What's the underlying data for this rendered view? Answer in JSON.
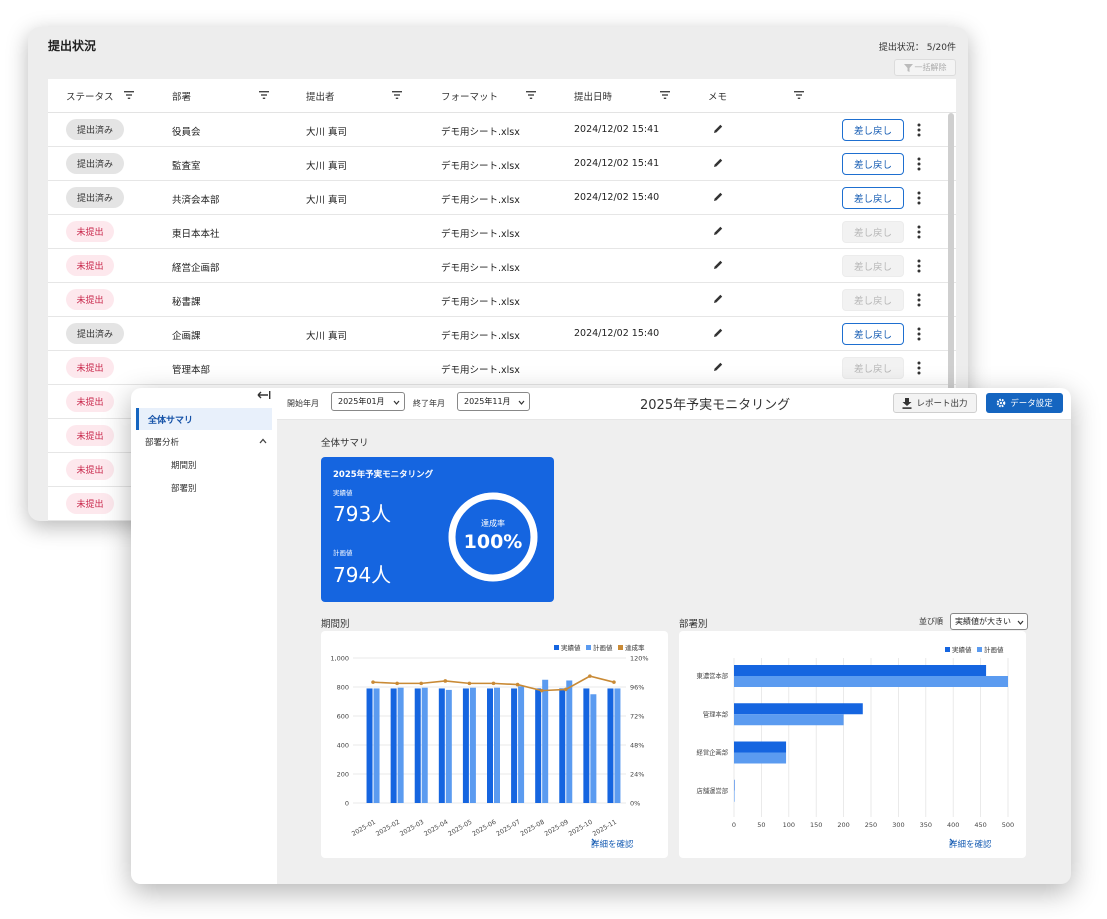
{
  "status_window": {
    "title": "提出状況",
    "count_text": "提出状況： 5/20件",
    "clear_button": "一括解除",
    "columns": [
      "ステータス",
      "部署",
      "提出者",
      "フォーマット",
      "提出日時",
      "メモ"
    ],
    "return_label": "差し戻し",
    "rows": [
      {
        "status": "提出済み",
        "dept": "役員会",
        "submitter": "大川 真司",
        "format": "デモ用シート.xlsx",
        "date": "2024/12/02 15:41"
      },
      {
        "status": "提出済み",
        "dept": "監査室",
        "submitter": "大川 真司",
        "format": "デモ用シート.xlsx",
        "date": "2024/12/02 15:41"
      },
      {
        "status": "提出済み",
        "dept": "共済会本部",
        "submitter": "大川 真司",
        "format": "デモ用シート.xlsx",
        "date": "2024/12/02 15:40"
      },
      {
        "status": "未提出",
        "dept": "東日本本社",
        "submitter": "",
        "format": "デモ用シート.xlsx",
        "date": ""
      },
      {
        "status": "未提出",
        "dept": "経営企画部",
        "submitter": "",
        "format": "デモ用シート.xlsx",
        "date": ""
      },
      {
        "status": "未提出",
        "dept": "秘書課",
        "submitter": "",
        "format": "デモ用シート.xlsx",
        "date": ""
      },
      {
        "status": "提出済み",
        "dept": "企画課",
        "submitter": "大川 真司",
        "format": "デモ用シート.xlsx",
        "date": "2024/12/02 15:40"
      },
      {
        "status": "未提出",
        "dept": "管理本部",
        "submitter": "",
        "format": "デモ用シート.xlsx",
        "date": ""
      },
      {
        "status": "未提出",
        "dept": "",
        "submitter": "",
        "format": "",
        "date": ""
      },
      {
        "status": "未提出",
        "dept": "",
        "submitter": "",
        "format": "",
        "date": ""
      },
      {
        "status": "未提出",
        "dept": "",
        "submitter": "",
        "format": "",
        "date": ""
      },
      {
        "status": "未提出",
        "dept": "",
        "submitter": "",
        "format": "",
        "date": ""
      }
    ]
  },
  "dashboard": {
    "sidebar": {
      "items": [
        {
          "label": "全体サマリ"
        },
        {
          "label": "部署分析"
        },
        {
          "label": "期間別"
        },
        {
          "label": "部署別"
        }
      ]
    },
    "topbar": {
      "start_label": "開始年月",
      "start_value": "2025年01月",
      "end_label": "終了年月",
      "end_value": "2025年11月",
      "title": "2025年予実モニタリング",
      "report_button": "レポート出力",
      "data_button": "データ設定"
    },
    "summary": {
      "section_label": "全体サマリ",
      "card_title": "2025年予実モニタリング",
      "actual_label": "実績値",
      "actual_value": "793人",
      "plan_label": "計画値",
      "plan_value": "794人",
      "rate_label": "達成率",
      "rate_value": "100%",
      "rate_fraction": 1.0
    },
    "period_section_label": "期間別",
    "dept_section_label": "部署別",
    "sort_label": "並び順",
    "sort_value": "実績値が大きい",
    "detail_link": "詳細を確認",
    "colors": {
      "actual": "#1565e0",
      "plan": "#5b9bf0",
      "rate": "#c98a35",
      "card_blue": "#1565e0"
    }
  },
  "chart_data": [
    {
      "type": "bar",
      "categories": [
        "2025-01",
        "2025-02",
        "2025-03",
        "2025-04",
        "2025-05",
        "2025-06",
        "2025-07",
        "2025-08",
        "2025-09",
        "2025-10",
        "2025-11"
      ],
      "series": [
        {
          "name": "実績値",
          "values": [
            790,
            790,
            790,
            790,
            790,
            790,
            790,
            790,
            790,
            790,
            790
          ],
          "axis": "left"
        },
        {
          "name": "計画値",
          "values": [
            790,
            795,
            795,
            780,
            795,
            795,
            805,
            850,
            845,
            750,
            790
          ],
          "axis": "left"
        },
        {
          "name": "達成率",
          "type": "line",
          "values": [
            100,
            99,
            99,
            101,
            99,
            99,
            98,
            93,
            94,
            105,
            100
          ],
          "axis": "right"
        }
      ],
      "y_left_ticks": [
        "0",
        "200",
        "400",
        "600",
        "800",
        "1,000"
      ],
      "y_right_ticks": [
        "0%",
        "24%",
        "48%",
        "72%",
        "96%",
        "120%"
      ],
      "ylim": [
        0,
        1000
      ],
      "y2lim": [
        0,
        120
      ],
      "legend": "top-right",
      "grid": true
    },
    {
      "type": "bar",
      "orientation": "horizontal",
      "categories": [
        "東濃営本部",
        "管理本部",
        "経営企画部",
        "店舗運営部"
      ],
      "series": [
        {
          "name": "実績値",
          "values": [
            460,
            235,
            95,
            1
          ]
        },
        {
          "name": "計画値",
          "values": [
            500,
            200,
            95,
            1
          ]
        }
      ],
      "x_ticks": [
        "0",
        "50",
        "100",
        "150",
        "200",
        "250",
        "300",
        "350",
        "400",
        "450",
        "500"
      ],
      "xlim": [
        0,
        500
      ],
      "legend": "top-right",
      "grid": true
    }
  ]
}
